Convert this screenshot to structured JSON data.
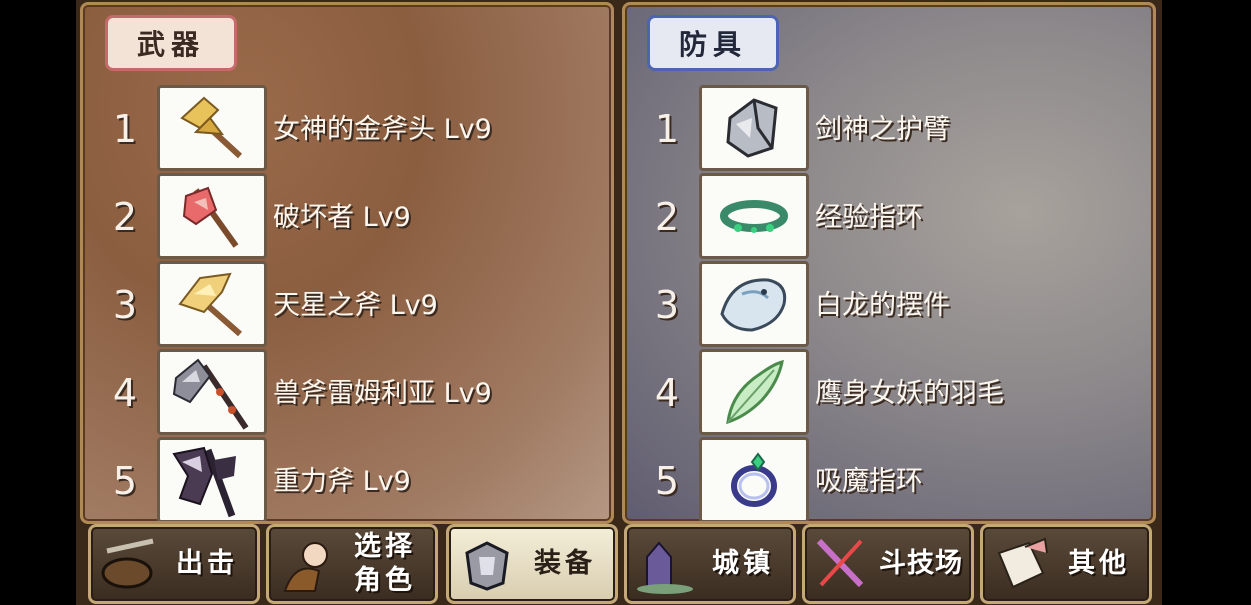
{
  "weapons": {
    "title": "武器",
    "items": [
      {
        "num": "1",
        "name": "女神的金斧头 Lv9",
        "icon": "golden-axe-icon"
      },
      {
        "num": "2",
        "name": "破坏者 Lv9",
        "icon": "red-axe-icon"
      },
      {
        "num": "3",
        "name": "天星之斧 Lv9",
        "icon": "star-axe-icon"
      },
      {
        "num": "4",
        "name": "兽斧雷姆利亚 Lv9",
        "icon": "beast-axe-icon"
      },
      {
        "num": "5",
        "name": "重力斧 Lv9",
        "icon": "gravity-axe-icon"
      }
    ]
  },
  "armor": {
    "title": "防具",
    "items": [
      {
        "num": "1",
        "name": "剑神之护臂",
        "icon": "gauntlet-icon"
      },
      {
        "num": "2",
        "name": "经验指环",
        "icon": "ring-icon"
      },
      {
        "num": "3",
        "name": "白龙的摆件",
        "icon": "white-dragon-icon"
      },
      {
        "num": "4",
        "name": "鹰身女妖的羽毛",
        "icon": "feather-icon"
      },
      {
        "num": "5",
        "name": "吸魔指环",
        "icon": "magic-ring-icon"
      }
    ]
  },
  "toolbar": {
    "sortie": "出击",
    "select_line1": "选择",
    "select_line2": "角色",
    "equip": "装备",
    "town": "城镇",
    "arena": "斗技场",
    "other": "其他"
  },
  "colors": {
    "weapon_header_border": "#c46a6a",
    "armor_header_border": "#4f64b0",
    "active_tab": "#f4eed8"
  }
}
